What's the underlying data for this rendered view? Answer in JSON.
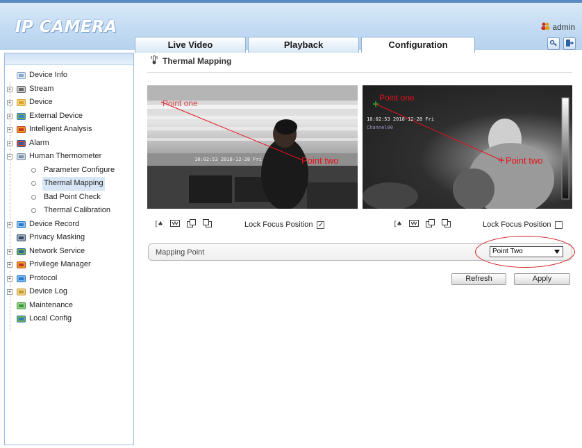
{
  "header": {
    "logo": "IP CAMERA",
    "user": "admin",
    "tabs": [
      {
        "label": "Live Video"
      },
      {
        "label": "Playback"
      },
      {
        "label": "Configuration",
        "active": true
      }
    ]
  },
  "sidebar": {
    "items": [
      {
        "label": "Device Info",
        "icon": "device-info-icon",
        "expandable": false
      },
      {
        "label": "Stream",
        "icon": "stream-icon",
        "expandable": true
      },
      {
        "label": "Device",
        "icon": "folder-icon",
        "expandable": true
      },
      {
        "label": "External Device",
        "icon": "external-device-icon",
        "expandable": true
      },
      {
        "label": "Intelligent Analysis",
        "icon": "intelligent-analysis-icon",
        "expandable": true
      },
      {
        "label": "Alarm",
        "icon": "alarm-icon",
        "expandable": true
      },
      {
        "label": "Human Thermometer",
        "icon": "thermometer-icon",
        "expandable": true,
        "expanded": true
      },
      {
        "label": "Parameter Configure",
        "sub": true
      },
      {
        "label": "Thermal Mapping",
        "sub": true,
        "selected": true
      },
      {
        "label": "Bad Point Check",
        "sub": true
      },
      {
        "label": "Thermal Calibration",
        "sub": true
      },
      {
        "label": "Device Record",
        "icon": "device-record-icon",
        "expandable": true
      },
      {
        "label": "Privacy Masking",
        "icon": "privacy-masking-icon",
        "expandable": false
      },
      {
        "label": "Network Service",
        "icon": "network-service-icon",
        "expandable": true
      },
      {
        "label": "Privilege Manager",
        "icon": "privilege-manager-icon",
        "expandable": true
      },
      {
        "label": "Protocol",
        "icon": "protocol-icon",
        "expandable": true
      },
      {
        "label": "Device Log",
        "icon": "device-log-icon",
        "expandable": true
      },
      {
        "label": "Maintenance",
        "icon": "maintenance-icon",
        "expandable": false
      },
      {
        "label": "Local Config",
        "icon": "local-config-icon",
        "expandable": false
      }
    ]
  },
  "main": {
    "title": "Thermal Mapping",
    "left_video": {
      "osd_time": "10:02:53 2018-12-28 Fri",
      "point_one": "Point one",
      "point_two": "Point two"
    },
    "right_video": {
      "osd_time": "10:02:53 2018-12-28 Fri",
      "osd_channel": "Channel00",
      "point_one": "Point one",
      "point_two": "Point two"
    },
    "lock_focus_left": {
      "label": "Lock Focus Position",
      "checked": true,
      "mark": "✓"
    },
    "lock_focus_right": {
      "label": "Lock Focus Position",
      "checked": false,
      "mark": ""
    },
    "mapping": {
      "label": "Mapping Point",
      "selected": "Point Two"
    },
    "buttons": {
      "refresh": "Refresh",
      "apply": "Apply"
    }
  },
  "colors": {
    "header_bg": "#c3dbf3",
    "annotation_red": "#e8121a",
    "selection_bg": "#d8e6f6"
  }
}
